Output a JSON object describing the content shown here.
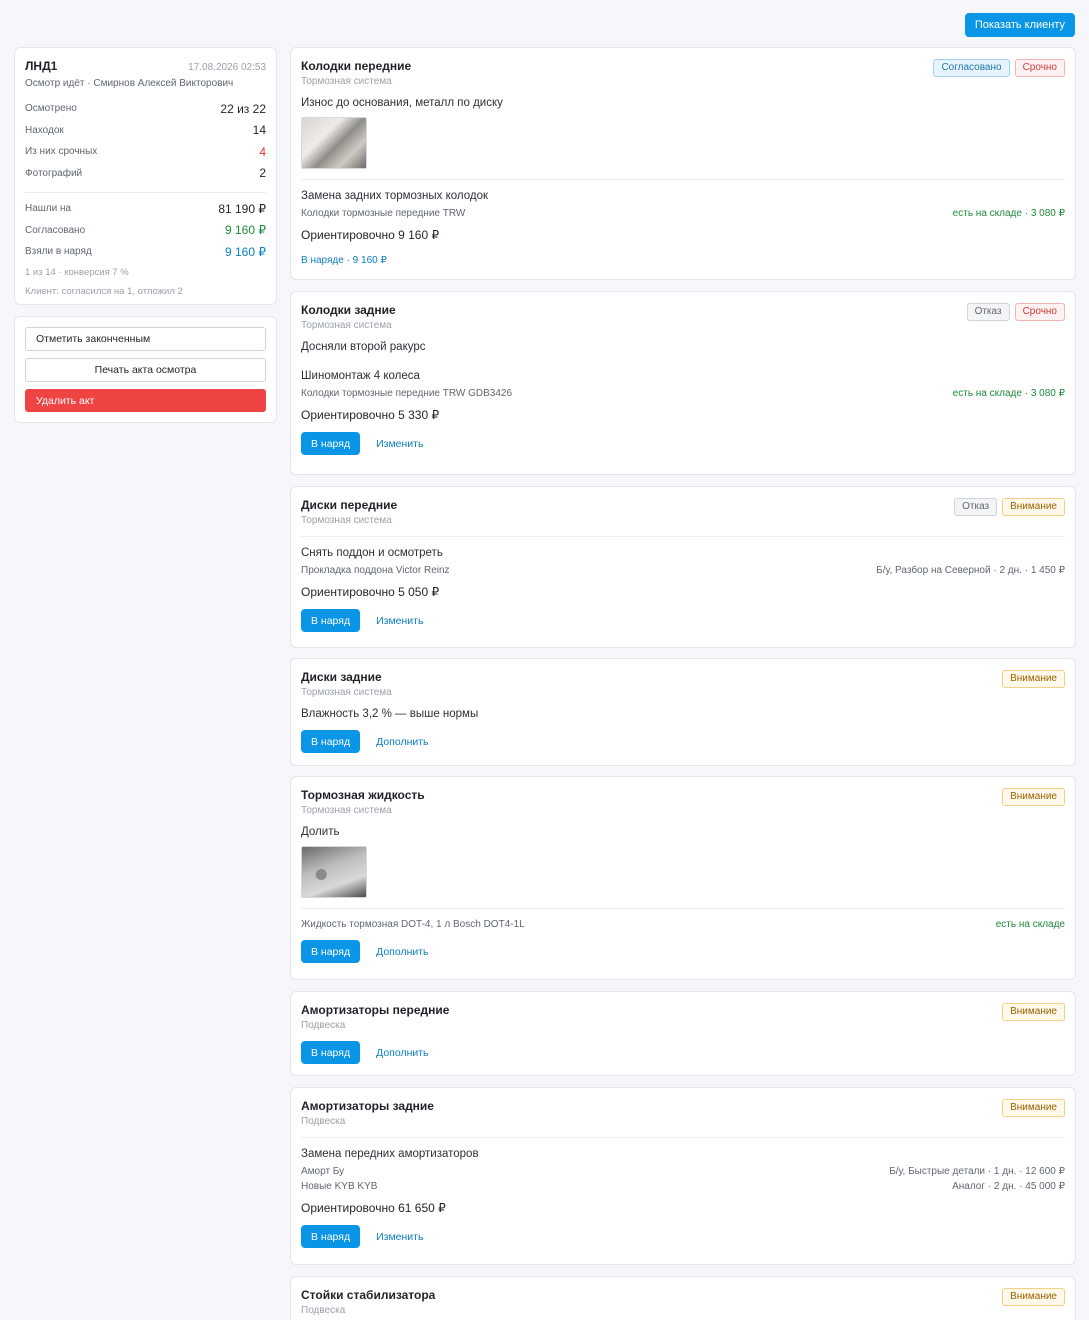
{
  "header": {
    "show_client_label": "Показать клиенту"
  },
  "summary": {
    "title": "ЛНД1",
    "date": "17.08.2026 02:53",
    "subtitle": "Осмотр идёт · Смирнов Алексей Викторович",
    "stats": [
      {
        "label": "Осмотрено",
        "value": "22 из 22"
      },
      {
        "label": "Находок",
        "value": "14"
      },
      {
        "label": "Из них срочных",
        "value": "4"
      },
      {
        "label": "Фотографий",
        "value": "2"
      }
    ],
    "money": [
      {
        "label": "Нашли на",
        "value": "81 190 ₽"
      },
      {
        "label": "Согласовано",
        "value": "9 160 ₽"
      },
      {
        "label": "Взяли в наряд",
        "value": "9 160 ₽"
      }
    ],
    "conversion_note": "1 из 14 · конверсия 7 %",
    "client_note": "Клиент: согласился на 1, отложил 2"
  },
  "actions": {
    "mark_finished": "Отметить законченным",
    "print_act": "Печать акта осмотра",
    "delete_act": "Удалить акт"
  },
  "items": [
    {
      "title": "Колодки передние",
      "category": "Тормозная система",
      "badges": [
        "Согласовано",
        "Срочно"
      ],
      "description": "Износ до основания, металл по диску",
      "service": "Замена задних тормозных колодок",
      "part": "Колодки тормозные передние TRW",
      "part_status": "есть на складе · 3 080 ₽",
      "estimate": "Ориентировочно 9 160 ₽",
      "in_order": "В наряде · 9 160 ₽"
    },
    {
      "title": "Колодки задние",
      "category": "Тормозная система",
      "badges": [
        "Отказ",
        "Срочно"
      ],
      "description": "Досняли второй ракурс",
      "service": "Шиномонтаж 4 колеса",
      "part": "Колодки тормозные передние TRW GDB3426",
      "part_status": "есть на складе · 3 080 ₽",
      "estimate": "Ориентировочно 5 330 ₽",
      "order_btn": "В наряд",
      "link": "Изменить"
    },
    {
      "title": "Диски передние",
      "category": "Тормозная система",
      "badges": [
        "Отказ",
        "Внимание"
      ],
      "service": "Снять поддон и осмотреть",
      "part": "Прокладка поддона Victor Reinz",
      "part_status": "Б/у, Разбор на Северной · 2 дн. · 1 450 ₽",
      "estimate": "Ориентировочно 5 050 ₽",
      "order_btn": "В наряд",
      "link": "Изменить"
    },
    {
      "title": "Диски задние",
      "category": "Тормозная система",
      "badges": [
        "Внимание"
      ],
      "description": "Влажность 3,2 % — выше нормы",
      "order_btn": "В наряд",
      "link": "Дополнить"
    },
    {
      "title": "Тормозная жидкость",
      "category": "Тормозная система",
      "badges": [
        "Внимание"
      ],
      "description": "Долить",
      "part": "Жидкость тормозная DOT-4, 1 л Bosch DOT4-1L",
      "part_status": "есть на складе",
      "order_btn": "В наряд",
      "link": "Дополнить"
    },
    {
      "title": "Амортизаторы передние",
      "category": "Подвеска",
      "badges": [
        "Внимание"
      ],
      "order_btn": "В наряд",
      "link": "Дополнить"
    },
    {
      "title": "Амортизаторы задние",
      "category": "Подвеска",
      "badges": [
        "Внимание"
      ],
      "service": "Замена передних амортизаторов",
      "part": "Аморт Бу",
      "part_status": "Б/у, Быстрые детали · 1 дн. · 12 600 ₽",
      "part2": "Новые KYB KYB",
      "part2_status": "Аналог · 2 дн. · 45 000 ₽",
      "estimate": "Ориентировочно 61 650 ₽",
      "order_btn": "В наряд",
      "link": "Изменить"
    },
    {
      "title": "Стойки стабилизатора",
      "category": "Подвеска",
      "badges": [
        "Внимание"
      ]
    }
  ]
}
